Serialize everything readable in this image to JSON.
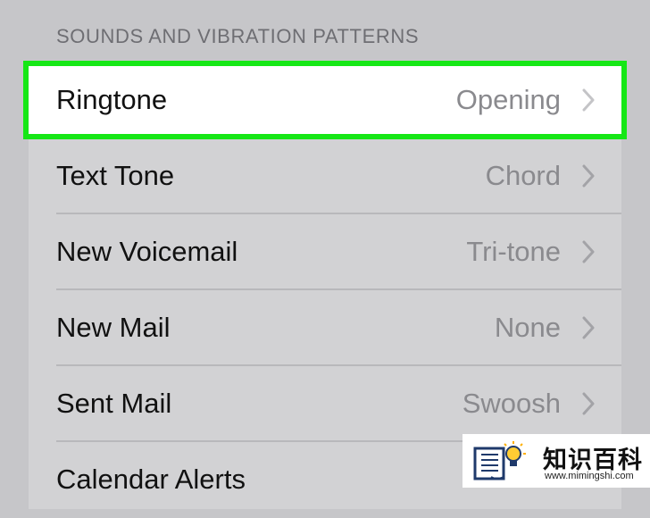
{
  "section": {
    "header": "SOUNDS AND VIBRATION PATTERNS"
  },
  "rows": [
    {
      "label": "Ringtone",
      "value": "Opening"
    },
    {
      "label": "Text Tone",
      "value": "Chord"
    },
    {
      "label": "New Voicemail",
      "value": "Tri-tone"
    },
    {
      "label": "New Mail",
      "value": "None"
    },
    {
      "label": "Sent Mail",
      "value": "Swoosh"
    },
    {
      "label": "Calendar Alerts",
      "value": ""
    }
  ],
  "selected_row": "Ringtone",
  "colors": {
    "highlight": "#16e716",
    "background": "#c6c6c9",
    "row_background": "#d2d2d4",
    "label_text": "#111111",
    "value_text": "#8a8a8e"
  },
  "watermark": {
    "brand": "知识百科",
    "url": "www.mimingshi.com"
  }
}
